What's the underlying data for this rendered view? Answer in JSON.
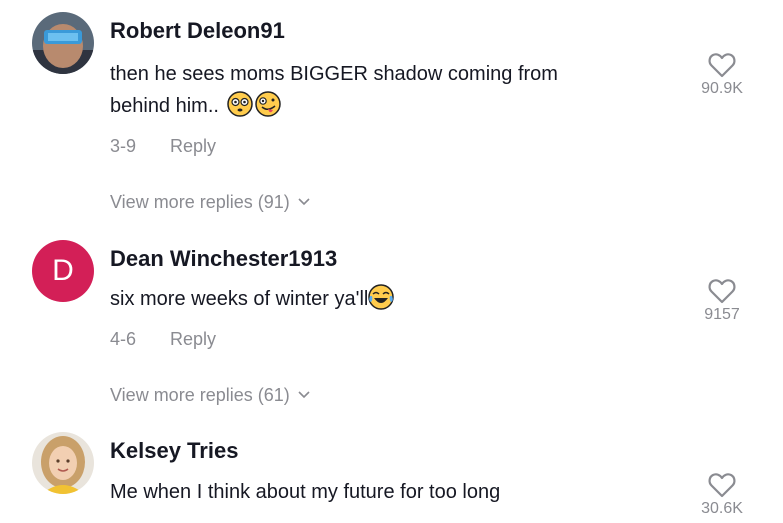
{
  "comments": [
    {
      "username": "Robert Deleon91",
      "text_line1": "then he sees moms BIGGER shadow coming from",
      "text_line2": "behind him..",
      "date": "3-9",
      "reply_label": "Reply",
      "view_more": "View more replies (91)",
      "likes": "90.9K"
    },
    {
      "username": "Dean Winchester1913",
      "avatar_letter": "D",
      "text": "six more weeks of winter ya'll",
      "date": "4-6",
      "reply_label": "Reply",
      "view_more": "View more replies (61)",
      "likes": "9157"
    },
    {
      "username": "Kelsey Tries",
      "text": "Me when I think about my future for too long",
      "likes": "30.6K"
    }
  ],
  "colors": {
    "text": "#161823",
    "muted": "#8a8b91",
    "avatar_d": "#d31f57"
  }
}
